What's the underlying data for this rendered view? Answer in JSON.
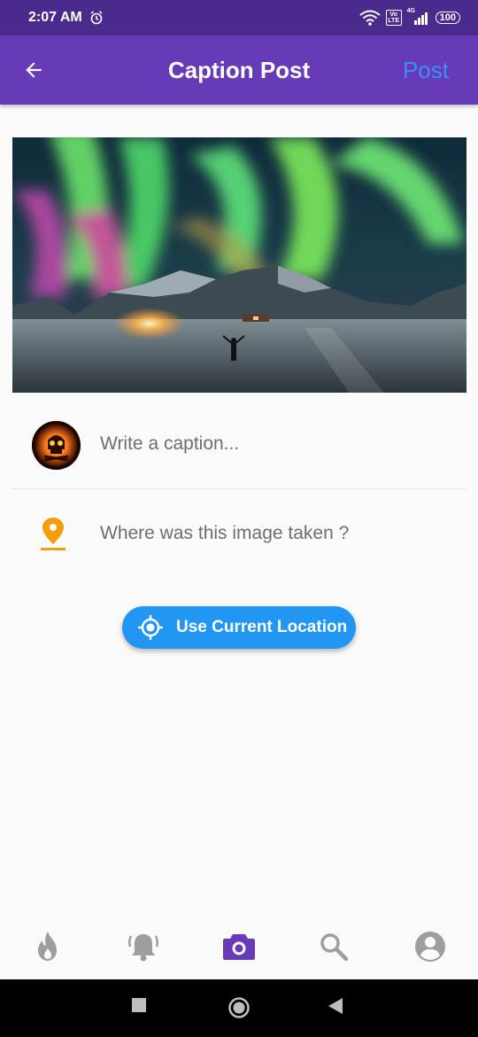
{
  "status_bar": {
    "time": "2:07 AM",
    "volte": "Vo LTE",
    "network": "4G",
    "battery": "100"
  },
  "header": {
    "title": "Caption Post",
    "post_label": "Post"
  },
  "caption": {
    "placeholder": "Write a caption..."
  },
  "location": {
    "placeholder": "Where was this image taken ?",
    "button_label": "Use Current Location"
  },
  "colors": {
    "status_bar": "#4a2a8c",
    "app_bar": "#673ab7",
    "post_text": "#3d8ff3",
    "location_button": "#2196f3",
    "pin_icon": "#f59e0b",
    "nav_active": "#673ab7",
    "nav_inactive": "#9e9e9e"
  },
  "bottom_nav": {
    "items": [
      {
        "icon": "flame-icon",
        "active": false
      },
      {
        "icon": "bell-icon",
        "active": false
      },
      {
        "icon": "camera-icon",
        "active": true
      },
      {
        "icon": "search-icon",
        "active": false
      },
      {
        "icon": "account-icon",
        "active": false
      }
    ]
  },
  "system_nav": {
    "items": [
      "recents-square-icon",
      "home-circle-icon",
      "back-triangle-icon"
    ]
  }
}
